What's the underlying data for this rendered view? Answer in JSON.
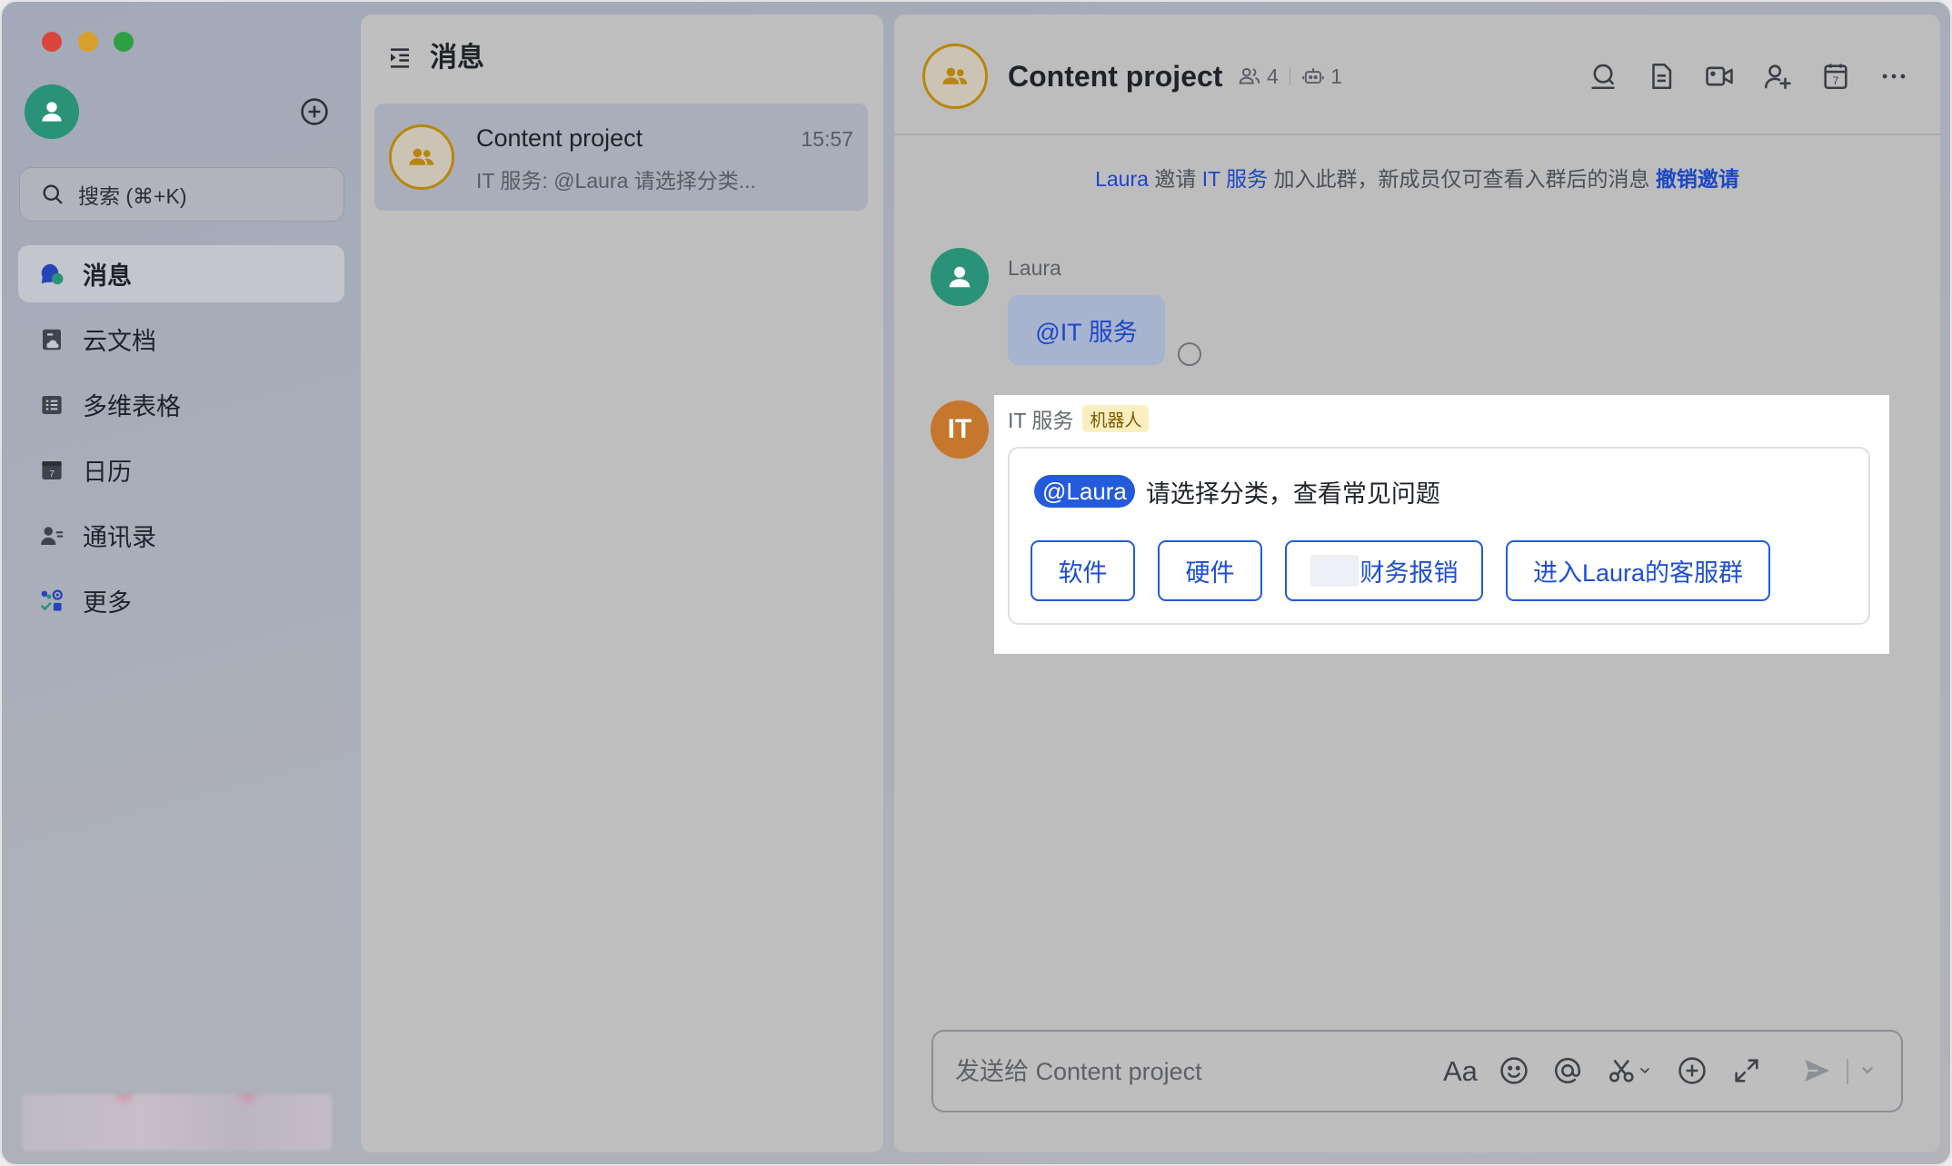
{
  "window": {
    "traffic_lights": {
      "close": "#d9453d",
      "minimize": "#d6a02c",
      "zoom": "#2ea043"
    }
  },
  "colors": {
    "accent": "#245bdb",
    "avatar_green": "#2a9276",
    "bot_orange": "#c5772d",
    "group_gold": "#b8860f"
  },
  "sidebar": {
    "add_icon": "plus-circle-icon",
    "search_icon": "search-icon",
    "search_placeholder": "搜索 (⌘+K)",
    "calendar_day": "7",
    "items": [
      {
        "label": "消息",
        "icon": "message-icon",
        "selected": true
      },
      {
        "label": "云文档",
        "icon": "docs-icon",
        "selected": false
      },
      {
        "label": "多维表格",
        "icon": "base-icon",
        "selected": false
      },
      {
        "label": "日历",
        "icon": "calendar-icon",
        "selected": false
      },
      {
        "label": "通讯录",
        "icon": "contacts-icon",
        "selected": false
      },
      {
        "label": "更多",
        "icon": "apps-icon",
        "selected": false
      }
    ]
  },
  "chat_list": {
    "title": "消息",
    "header_icon": "collapse-list-icon",
    "items": [
      {
        "title": "Content project",
        "time": "15:57",
        "preview": "IT 服务: @Laura 请选择分类...",
        "avatar_icon": "group-icon",
        "selected": true
      }
    ]
  },
  "chat": {
    "title": "Content project",
    "member_count": "4",
    "bot_count": "1",
    "calendar_day": "7",
    "toolbar_icons": [
      "search-icon",
      "document-icon",
      "video-call-icon",
      "add-member-icon",
      "calendar-icon",
      "more-icon"
    ],
    "system_message": {
      "actor": "Laura",
      "verb": "邀请",
      "target": "IT 服务",
      "text": "加入此群，新成员仅可查看入群后的消息",
      "action": "撤销邀请"
    },
    "messages": [
      {
        "sender": "Laura",
        "text": "@IT 服务",
        "read_status_icon": "unread-circle-icon"
      },
      {
        "sender": "IT 服务",
        "avatar_text": "IT",
        "tag": "机器人",
        "card": {
          "mention": "@Laura",
          "text": "请选择分类，查看常见问题",
          "buttons": [
            "软件",
            "硬件",
            "财务报销",
            "进入Laura的客服群"
          ]
        }
      }
    ],
    "input": {
      "placeholder": "发送给 Content project",
      "format_label": "Aa",
      "icons": [
        "emoji-icon",
        "at-icon",
        "scissors-icon",
        "plus-circle-icon",
        "expand-icon",
        "send-icon",
        "chevron-down-icon"
      ]
    }
  }
}
